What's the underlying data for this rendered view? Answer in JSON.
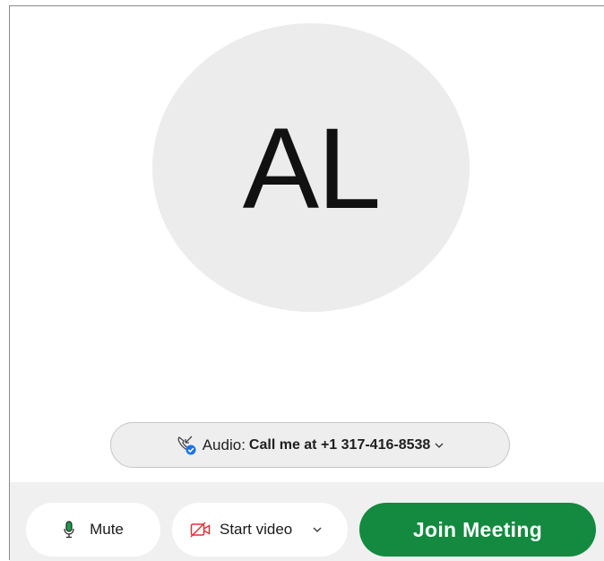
{
  "avatar": {
    "initials": "AL",
    "background_color": "#ececec"
  },
  "audio": {
    "prefix": "Audio:",
    "value": "Call me at +1 317-416-8538",
    "icon": "phone-callback-icon",
    "chevron_icon": "chevron-down-icon"
  },
  "controls": {
    "mute_label": "Mute",
    "mute_icon": "microphone-icon",
    "video_label": "Start video",
    "video_icon": "video-off-icon",
    "video_chevron_icon": "chevron-down-icon",
    "join_label": "Join Meeting"
  },
  "colors": {
    "join_button": "#138a3f",
    "mic_green": "#1d9a4a",
    "video_red": "#e0303a",
    "check_blue": "#1a73e8",
    "footer_bg": "#f0f0f0"
  }
}
